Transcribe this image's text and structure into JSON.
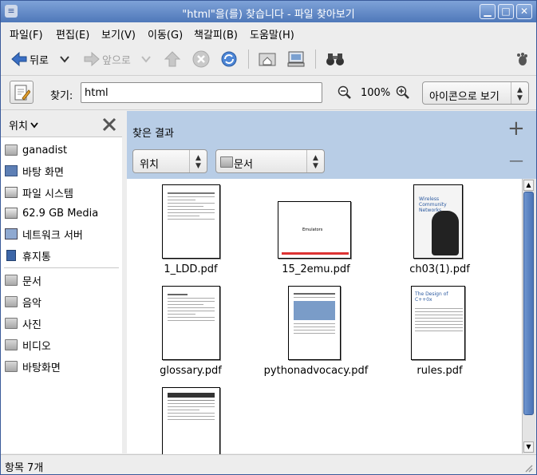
{
  "window": {
    "title": "\"html\"을(를) 찾습니다 - 파일 찾아보기"
  },
  "menu": [
    "파일(F)",
    "편집(E)",
    "보기(V)",
    "이동(G)",
    "책갈피(B)",
    "도움말(H)"
  ],
  "toolbar": {
    "back": "뒤로",
    "forward": "앞으로"
  },
  "location": {
    "label": "찾기:",
    "value": "html",
    "zoom": "100%",
    "view_mode": "아이콘으로 보기"
  },
  "sidebar": {
    "header": "위치",
    "places": [
      "ganadist",
      "바탕 화면",
      "파일 시스템",
      "62.9 GB Media",
      "네트워크 서버",
      "휴지통"
    ],
    "bookmarks": [
      "문서",
      "음악",
      "사진",
      "비디오",
      "바탕화면"
    ]
  },
  "search": {
    "title": "찾은 결과",
    "criterion": "위치",
    "folder": "문서",
    "add": "+",
    "remove": "—"
  },
  "files": [
    "1_LDD.pdf",
    "15_2emu.pdf",
    "ch03(1).pdf",
    "glossary.pdf",
    "pythonadvocacy.pdf",
    "rules.pdf",
    ""
  ],
  "thumbs": {
    "emu_title": "Emulators",
    "ch03_title": "Wireless Community Networks",
    "rules_title": "The Design of C++0x"
  },
  "status": "항목 7개"
}
